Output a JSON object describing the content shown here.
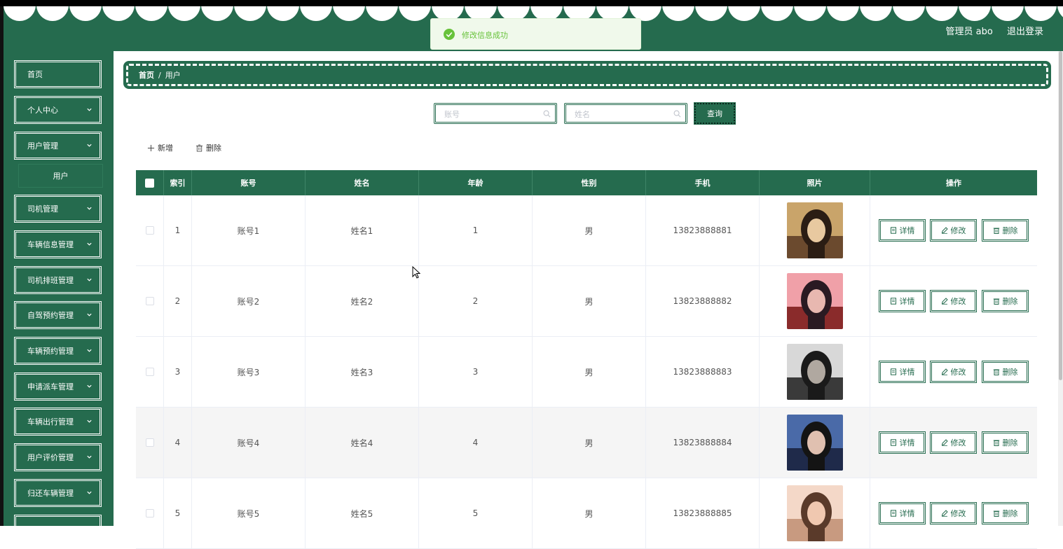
{
  "header": {
    "user_label": "管理员 abo",
    "logout_label": "退出登录"
  },
  "toast": {
    "message": "修改信息成功"
  },
  "sidebar": {
    "items": [
      {
        "label": "首页",
        "has_arrow": false
      },
      {
        "label": "个人中心",
        "has_arrow": true
      },
      {
        "label": "用户管理",
        "has_arrow": true
      },
      {
        "label": "司机管理",
        "has_arrow": true
      },
      {
        "label": "车辆信息管理",
        "has_arrow": true
      },
      {
        "label": "司机排班管理",
        "has_arrow": true
      },
      {
        "label": "自驾预约管理",
        "has_arrow": true
      },
      {
        "label": "车辆预约管理",
        "has_arrow": true
      },
      {
        "label": "申请派车管理",
        "has_arrow": true
      },
      {
        "label": "车辆出行管理",
        "has_arrow": true
      },
      {
        "label": "用户评价管理",
        "has_arrow": true
      },
      {
        "label": "归还车辆管理",
        "has_arrow": true
      }
    ],
    "sub_item": "用户"
  },
  "breadcrumb": {
    "home": "首页",
    "separator": "/",
    "current": "用户"
  },
  "search": {
    "account_placeholder": "账号",
    "name_placeholder": "姓名",
    "query_label": "查询"
  },
  "toolbar": {
    "add_label": "新增",
    "delete_label": "删除"
  },
  "table": {
    "columns": [
      "索引",
      "账号",
      "姓名",
      "年龄",
      "性别",
      "手机",
      "照片",
      "操作"
    ],
    "rows": [
      {
        "index": "1",
        "account": "账号1",
        "name": "姓名1",
        "age": "1",
        "gender": "男",
        "phone": "13823888881",
        "photo": "photo-1"
      },
      {
        "index": "2",
        "account": "账号2",
        "name": "姓名2",
        "age": "2",
        "gender": "男",
        "phone": "13823888882",
        "photo": "photo-2"
      },
      {
        "index": "3",
        "account": "账号3",
        "name": "姓名3",
        "age": "3",
        "gender": "男",
        "phone": "13823888883",
        "photo": "photo-3"
      },
      {
        "index": "4",
        "account": "账号4",
        "name": "姓名4",
        "age": "4",
        "gender": "男",
        "phone": "13823888884",
        "photo": "photo-4"
      },
      {
        "index": "5",
        "account": "账号5",
        "name": "姓名5",
        "age": "5",
        "gender": "男",
        "phone": "13823888885",
        "photo": "photo-5"
      }
    ],
    "actions": {
      "detail": "详情",
      "edit": "修改",
      "delete": "删除"
    }
  },
  "colors": {
    "primary": "#256b4e",
    "success": "#67c23a",
    "toast_bg": "#f0f9eb"
  }
}
